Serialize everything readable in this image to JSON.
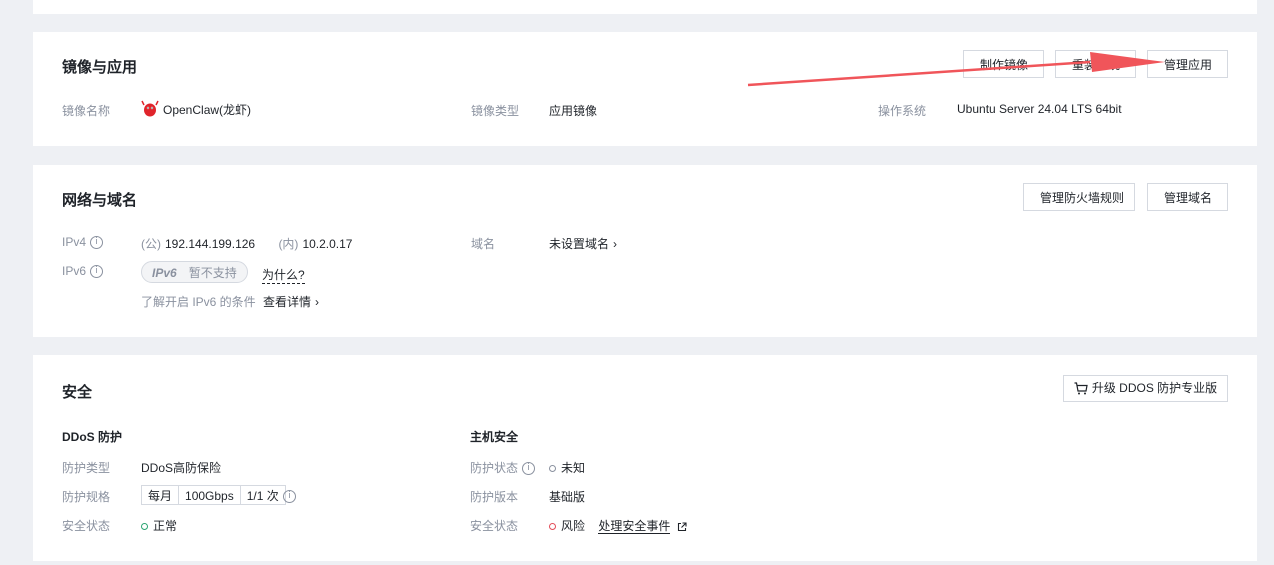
{
  "mirror": {
    "title": "镜像与应用",
    "buttons": {
      "make_image": "制作镜像",
      "reinstall": "重装系统",
      "manage_app": "管理应用"
    },
    "name_label": "镜像名称",
    "name_value": "OpenClaw(龙虾)",
    "type_label": "镜像类型",
    "type_value": "应用镜像",
    "os_label": "操作系统",
    "os_value": "Ubuntu Server 24.04 LTS 64bit"
  },
  "network": {
    "title": "网络与域名",
    "buttons": {
      "firewall": "管理防火墙规则",
      "domain": "管理域名"
    },
    "ipv4_label": "IPv4",
    "public_tag": "(公)",
    "public_ip": "192.144.199.126",
    "private_tag": "(内)",
    "private_ip": "10.2.0.17",
    "domain_label": "域名",
    "domain_value": "未设置域名",
    "ipv6_label": "IPv6",
    "ipv6_mark": "IPv6",
    "ipv6_status": "暂不支持",
    "why": "为什么?",
    "learn_text": "了解开启 IPv6 的条件",
    "learn_link": "查看详情"
  },
  "security": {
    "title": "安全",
    "upgrade_button": "升级 DDOS 防护专业版",
    "ddos": {
      "title": "DDoS 防护",
      "type_label": "防护类型",
      "type_value": "DDoS高防保险",
      "spec_label": "防护规格",
      "spec_period": "每月",
      "spec_bandwidth": "100Gbps",
      "spec_count": "1/1 次",
      "status_label": "安全状态",
      "status_value": "正常"
    },
    "host": {
      "title": "主机安全",
      "status_label": "防护状态",
      "status_value": "未知",
      "version_label": "防护版本",
      "version_value": "基础版",
      "safety_label": "安全状态",
      "safety_value": "风险",
      "handle_link": "处理安全事件"
    }
  },
  "colors": {
    "ok": "#2ba471",
    "risk": "#e34d59",
    "unknown": "#8a919f",
    "arrow": "#f0555a"
  }
}
